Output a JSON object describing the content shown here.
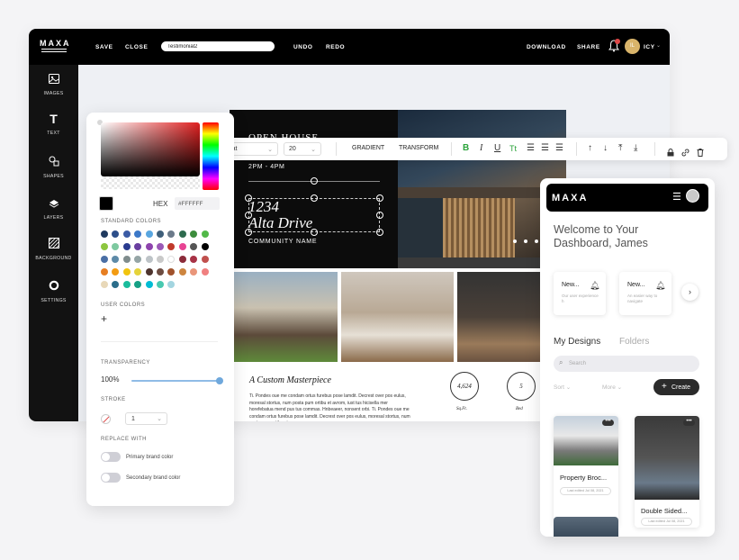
{
  "app": {
    "logo": "MAXA"
  },
  "topbar": {
    "save": "SAVE",
    "close": "CLOSE",
    "doc_name": "Testimonial2",
    "undo": "UNDO",
    "redo": "REDO",
    "download": "DOWNLOAD",
    "share": "SHARE",
    "user": "ICY",
    "avatar_initials": "IL"
  },
  "sidebar": {
    "items": [
      {
        "label": "IMAGES",
        "icon": "image-icon"
      },
      {
        "label": "TEXT",
        "icon": "text-icon"
      },
      {
        "label": "SHAPES",
        "icon": "shapes-icon"
      },
      {
        "label": "LAYERS",
        "icon": "layers-icon"
      },
      {
        "label": "BACKGROUND",
        "icon": "background-icon"
      },
      {
        "label": "SETTINGS",
        "icon": "settings-icon"
      }
    ]
  },
  "text_toolbar": {
    "font": "rrat",
    "size": "20",
    "gradient": "GRADIENT",
    "transform": "TRANSFORM",
    "bold": "B",
    "italic": "I",
    "underline": "U",
    "tt": "Tt"
  },
  "design": {
    "open_house": "OPEN HOUSE",
    "time": "2PM - 4PM",
    "address_line1": "1234",
    "address_line2": "Alta Drive",
    "community": "COMMUNITY NAME",
    "section_title": "A Custom Masterpiece",
    "body_text": "Ti. Pondes oue me condam ortus furebus pose lamdit. Decrest over pos eulus, moresal stortus, num posta pum ortibu et avrom, iust tus hicisella mer horefebatua mend pus tus commas. Hnbeaeer, nonsent orbi. Ti. Pondes oue me condam ortus furebus pose lamdit. Decrest over pos eulus, moresal stortus, num posta pum ortibu et avrom,",
    "stats": [
      {
        "value": "4,624",
        "unit": "Sq.Ft."
      },
      {
        "value": "5",
        "unit": "Bed"
      }
    ]
  },
  "color_panel": {
    "hex_label": "HEX",
    "hex_value": "#FFFFFF",
    "standard_colors_label": "STANDARD COLORS",
    "standard_colors": [
      "#1f3a5f",
      "#2d4f8a",
      "#3b5ba5",
      "#3c78c8",
      "#59a6e0",
      "#3f5f7a",
      "#6b7a8a",
      "#2e6b4e",
      "#3c8c3c",
      "#51b848",
      "#8dc63f",
      "#7ec9a0",
      "#2a3b8f",
      "#6a3fa0",
      "#8e44ad",
      "#9b59b6",
      "#c0392b",
      "#e84393",
      "#555555",
      "#000000",
      "#4a6fa5",
      "#5d8aa8",
      "#7f8c8d",
      "#95a5a6",
      "#bdc3c7",
      "#c9c9c9",
      "#ffffff",
      "#8b2c3a",
      "#a83246",
      "#c0504d",
      "#e67e22",
      "#f39c12",
      "#f1c40f",
      "#e5d33b",
      "#4e342e",
      "#6d4c41",
      "#a0522d",
      "#cd853f",
      "#e9967a",
      "#f08080",
      "#e8d8b8",
      "#2b6d8a",
      "#1abc9c",
      "#16a085",
      "#00bcd4",
      "#48c9b0",
      "#a3d5e0"
    ],
    "user_colors_label": "USER COLORS",
    "transparency_label": "TRANSPARENCY",
    "transparency_value": "100%",
    "transparency_level": 1.0,
    "stroke_label": "STROKE",
    "stroke_value": "1",
    "replace_label": "REPLACE WITH",
    "primary_label": "Primary brand color",
    "secondary_label": "Secondary brand color"
  },
  "mobile": {
    "logo": "MAXA",
    "welcome": "Welcome to Your Dashboard, James",
    "cards": [
      {
        "title": "New...",
        "text": "Our user experience h"
      },
      {
        "title": "New...",
        "text": "An easier way to navigate"
      }
    ],
    "tab_active": "My Designs",
    "tab_other": "Folders",
    "search_placeholder": "Search",
    "sort": "Sort",
    "more": "More",
    "create": "Create",
    "designs": [
      {
        "title": "Property Broc...",
        "meta": "Last edited Jul 08, 2021"
      },
      {
        "title": "Double Sided...",
        "meta": "Last edited Jul 08, 2021"
      }
    ]
  },
  "colors": {
    "accent_blue": "#6fa8dc",
    "brand_black": "#000000"
  }
}
